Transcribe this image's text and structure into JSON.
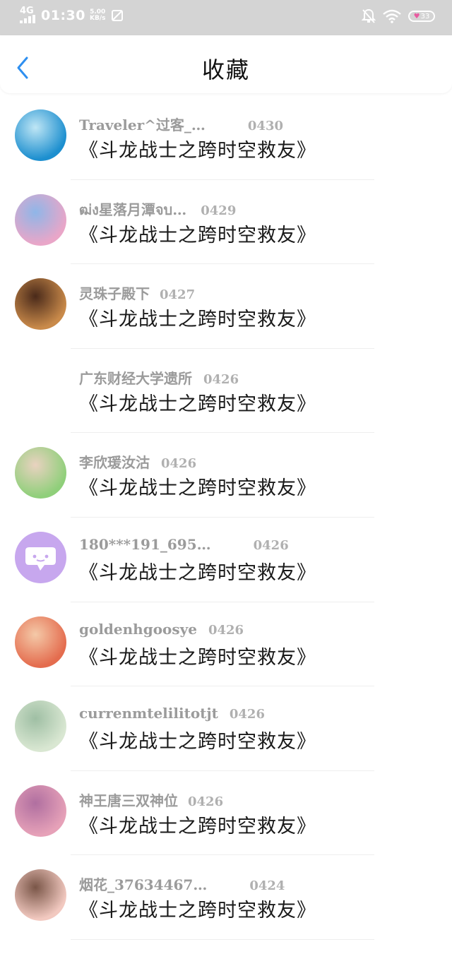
{
  "status_bar": {
    "network": "4G",
    "time": "01:30",
    "speed_value": "5.00",
    "speed_unit": "KB/s",
    "battery": "33"
  },
  "header": {
    "title": "收藏"
  },
  "favorites": [
    {
      "user": "Traveler^过客_…",
      "date": "0430",
      "book": "《斗龙战士之跨时空救友》",
      "avatar_colors": [
        "#1d8fcf",
        "#bfe6f5"
      ]
    },
    {
      "user": "ฒ่ง星落月潭จบ…",
      "date": "0429",
      "book": "《斗龙战士之跨时空救友》",
      "avatar_colors": [
        "#e9a6c8",
        "#8fb6e8"
      ]
    },
    {
      "user": "灵珠子殿下",
      "date": "0427",
      "book": "《斗龙战士之跨时空救友》",
      "avatar_colors": [
        "#c98a4a",
        "#4a2a1a"
      ]
    },
    {
      "user": "广东财经大学遗所",
      "date": "0426",
      "book": "《斗龙战士之跨时空救友》",
      "avatar_colors": [
        "#ffffff",
        "#ffffff"
      ]
    },
    {
      "user": "李欣瑗汝沽",
      "date": "0426",
      "book": "《斗龙战士之跨时空救友》",
      "avatar_colors": [
        "#8fcf7a",
        "#e9d2c0"
      ]
    },
    {
      "user": "180***191_695…",
      "date": "0426",
      "book": "《斗龙战士之跨时空救友》",
      "avatar_colors": [
        "#c7a7ee",
        "#c7a7ee"
      ]
    },
    {
      "user": "goldenhgoosye",
      "date": "0426",
      "book": "《斗龙战士之跨时空救友》",
      "avatar_colors": [
        "#e46c4e",
        "#f4c9a8"
      ]
    },
    {
      "user": "currenmtelilitotjt",
      "date": "0426",
      "book": "《斗龙战士之跨时空救友》",
      "avatar_colors": [
        "#d9e7d2",
        "#9fbfa4"
      ]
    },
    {
      "user": "神王唐三双神位",
      "date": "0426",
      "book": "《斗龙战士之跨时空救友》",
      "avatar_colors": [
        "#e6a1b8",
        "#b06fa0"
      ]
    },
    {
      "user": "烟花_37634467…",
      "date": "0424",
      "book": "《斗龙战士之跨时空救友》",
      "avatar_colors": [
        "#f2c9c0",
        "#7a5648"
      ]
    }
  ]
}
